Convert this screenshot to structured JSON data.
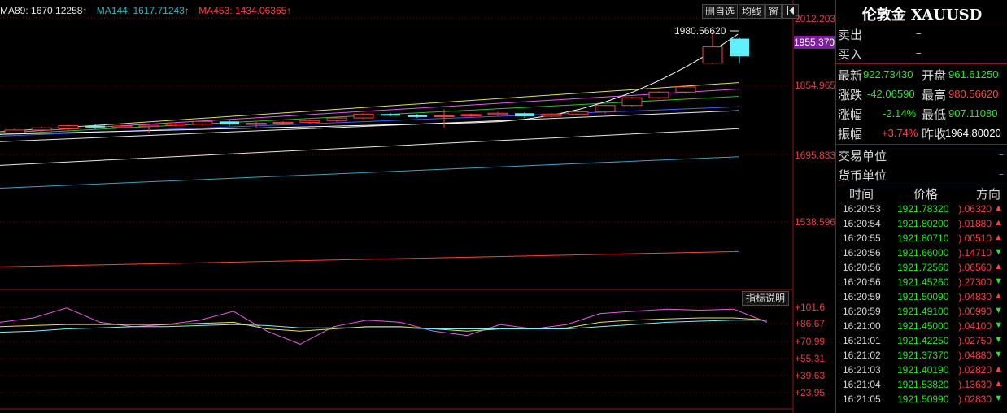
{
  "ma_legend": [
    {
      "text": "MA89: 1670.12258↑",
      "color": "#e8e8e8"
    },
    {
      "text": "MA144: 1617.71243↑",
      "color": "#40b0c0"
    },
    {
      "text": "MA453: 1434.06365↑",
      "color": "#ff4040"
    }
  ],
  "toolbar": {
    "delete_label": "删自选",
    "ma_label": "均线",
    "window_label": "窗",
    "toggle_icon": "panel-toggle-icon"
  },
  "y_axis": {
    "labels": [
      "2012.203",
      "1854.965",
      "1695.833",
      "1538.596"
    ],
    "current_price": "1955.370",
    "high_annotation": "1980.56620"
  },
  "indicator": {
    "button_label": "指标说明",
    "labels": [
      "+101.6",
      "+86.67",
      "+70.99",
      "+55.31",
      "+39.63",
      "+23.95"
    ]
  },
  "panel": {
    "title": "伦敦金 XAUUSD",
    "sell_label": "卖出",
    "sell_value": "–",
    "buy_label": "买入",
    "buy_value": "–",
    "latest_label": "最新",
    "latest_value": "922.73430",
    "open_label": "开盘",
    "open_value": "961.61250",
    "change_label": "涨跌",
    "change_value": "-42.06590",
    "high_label": "最高",
    "high_value": "980.56620",
    "pct_label": "涨幅",
    "pct_value": "-2.14%",
    "low_label": "最低",
    "low_value": "907.11080",
    "amp_label": "振幅",
    "amp_value": "+3.74%",
    "prev_label": "昨收",
    "prev_value": "1964.80020",
    "unit_label": "交易单位",
    "unit_value": "–",
    "currency_label": "货币单位",
    "currency_value": "–",
    "table_headers": [
      "时间",
      "价格",
      "方向"
    ],
    "ticks": [
      {
        "time": "16:20:53",
        "price": "1921.78320",
        "change": ").06320",
        "dir": "up"
      },
      {
        "time": "16:20:54",
        "price": "1921.80200",
        "change": ").01880",
        "dir": "up"
      },
      {
        "time": "16:20:55",
        "price": "1921.80710",
        "change": ").00510",
        "dir": "up"
      },
      {
        "time": "16:20:56",
        "price": "1921.66000",
        "change": ").14710",
        "dir": "down"
      },
      {
        "time": "16:20:56",
        "price": "1921.72560",
        "change": ").06560",
        "dir": "up"
      },
      {
        "time": "16:20:56",
        "price": "1921.45260",
        "change": ").27300",
        "dir": "down"
      },
      {
        "time": "16:20:59",
        "price": "1921.50090",
        "change": ").04830",
        "dir": "up"
      },
      {
        "time": "16:20:59",
        "price": "1921.49100",
        "change": ").00990",
        "dir": "down"
      },
      {
        "time": "16:21:00",
        "price": "1921.45000",
        "change": ").04100",
        "dir": "down"
      },
      {
        "time": "16:21:01",
        "price": "1921.42250",
        "change": ").02750",
        "dir": "down"
      },
      {
        "time": "16:21:02",
        "price": "1921.37370",
        "change": ").04880",
        "dir": "down"
      },
      {
        "time": "16:21:03",
        "price": "1921.40190",
        "change": ").02820",
        "dir": "up"
      },
      {
        "time": "16:21:04",
        "price": "1921.53820",
        "change": ").13630",
        "dir": "up"
      },
      {
        "time": "16:21:05",
        "price": "1921.50990",
        "change": ").02830",
        "dir": "down"
      }
    ]
  },
  "colors": {
    "up": "#ff4040",
    "down": "#30e030",
    "border": "#8a1a1a",
    "cur_bg": "#7a1f9a",
    "cyan": "#60f0ff"
  },
  "candles": [
    {
      "o": 1745,
      "c": 1752,
      "h": 1755,
      "l": 1740
    },
    {
      "o": 1752,
      "c": 1757,
      "h": 1760,
      "l": 1748
    },
    {
      "o": 1755,
      "c": 1762,
      "h": 1764,
      "l": 1750
    },
    {
      "o": 1762,
      "c": 1758,
      "h": 1765,
      "l": 1754
    },
    {
      "o": 1758,
      "c": 1761,
      "h": 1764,
      "l": 1755
    },
    {
      "o": 1760,
      "c": 1763,
      "h": 1766,
      "l": 1746
    },
    {
      "o": 1763,
      "c": 1766,
      "h": 1769,
      "l": 1760
    },
    {
      "o": 1766,
      "c": 1772,
      "h": 1774,
      "l": 1762
    },
    {
      "o": 1772,
      "c": 1765,
      "h": 1775,
      "l": 1761
    },
    {
      "o": 1765,
      "c": 1768,
      "h": 1771,
      "l": 1756
    },
    {
      "o": 1768,
      "c": 1770,
      "h": 1773,
      "l": 1765
    },
    {
      "o": 1770,
      "c": 1774,
      "h": 1776,
      "l": 1767
    },
    {
      "o": 1774,
      "c": 1780,
      "h": 1782,
      "l": 1771
    },
    {
      "o": 1780,
      "c": 1789,
      "h": 1791,
      "l": 1777
    },
    {
      "o": 1789,
      "c": 1786,
      "h": 1791,
      "l": 1784
    },
    {
      "o": 1786,
      "c": 1783,
      "h": 1789,
      "l": 1780
    },
    {
      "o": 1783,
      "c": 1785,
      "h": 1800,
      "l": 1758
    },
    {
      "o": 1785,
      "c": 1788,
      "h": 1790,
      "l": 1781
    },
    {
      "o": 1788,
      "c": 1791,
      "h": 1794,
      "l": 1785
    },
    {
      "o": 1791,
      "c": 1784,
      "h": 1793,
      "l": 1780
    },
    {
      "o": 1784,
      "c": 1789,
      "h": 1791,
      "l": 1781
    },
    {
      "o": 1789,
      "c": 1794,
      "h": 1796,
      "l": 1786
    },
    {
      "o": 1794,
      "c": 1809,
      "h": 1811,
      "l": 1790
    },
    {
      "o": 1809,
      "c": 1827,
      "h": 1829,
      "l": 1806
    },
    {
      "o": 1827,
      "c": 1840,
      "h": 1842,
      "l": 1824
    },
    {
      "o": 1840,
      "c": 1852,
      "h": 1855,
      "l": 1837
    },
    {
      "o": 1907,
      "c": 1945,
      "h": 1980,
      "l": 1905
    },
    {
      "o": 1964,
      "c": 1923,
      "h": 1966,
      "l": 1907
    }
  ]
}
